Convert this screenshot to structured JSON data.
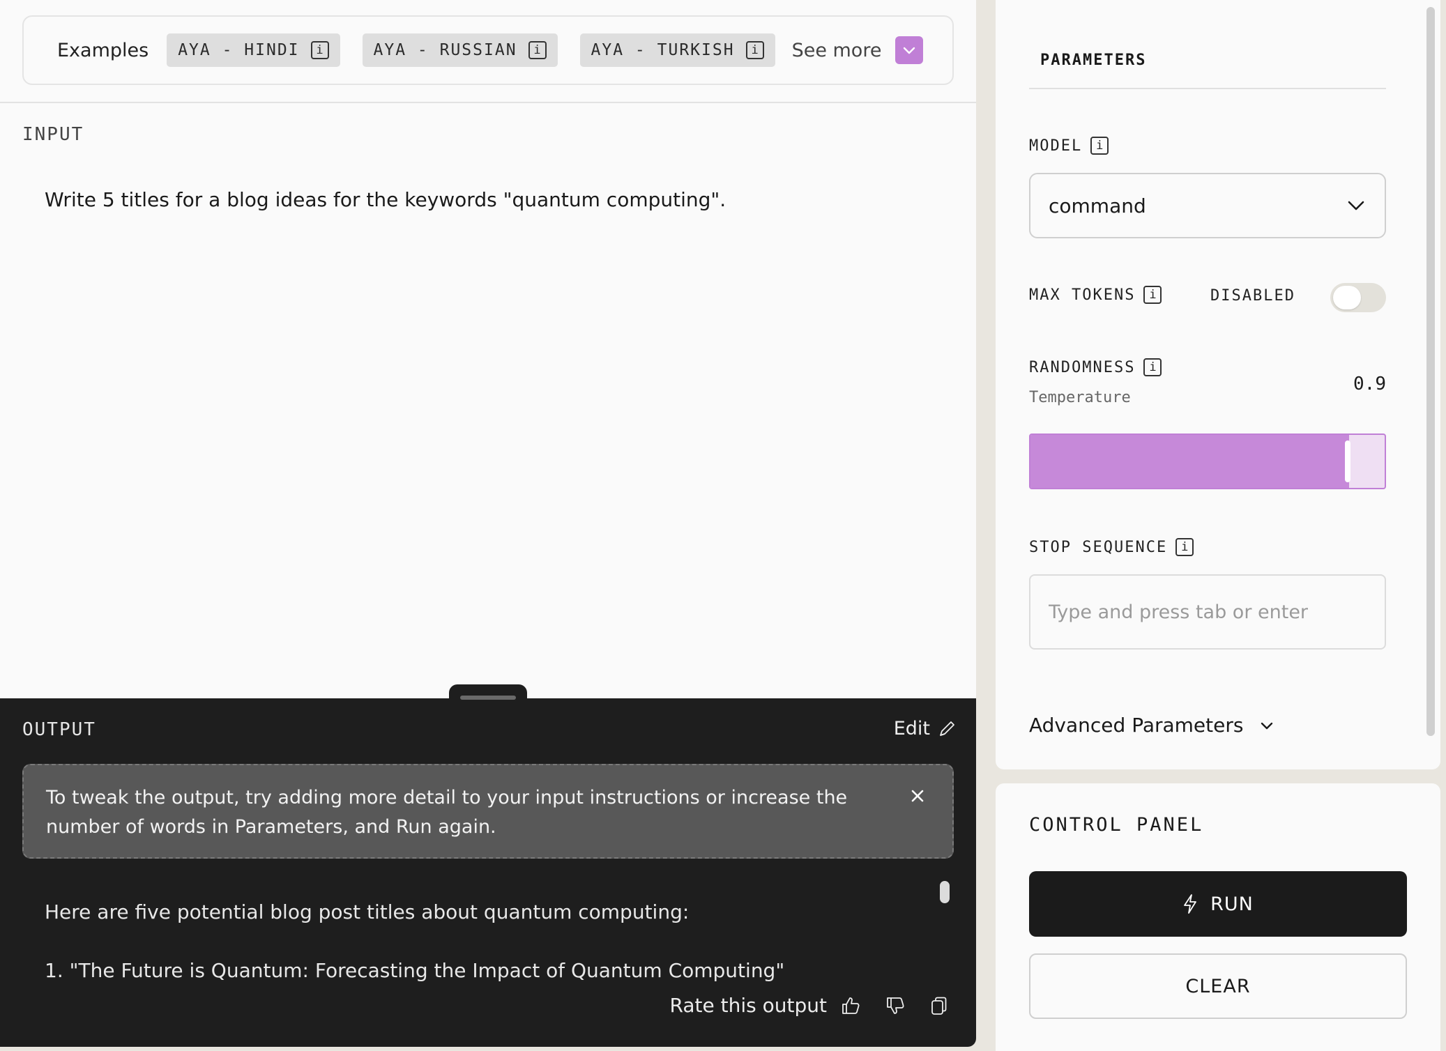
{
  "examples": {
    "label": "Examples",
    "chips": [
      {
        "label": "AYA - HINDI"
      },
      {
        "label": "AYA - RUSSIAN"
      },
      {
        "label": "AYA - TURKISH"
      }
    ],
    "see_more": "See more",
    "info_glyph": "i"
  },
  "input": {
    "label": "INPUT",
    "text": "Write 5 titles for a blog ideas for the keywords \"quantum computing\"."
  },
  "output": {
    "label": "OUTPUT",
    "edit_label": "Edit",
    "tip": "To tweak the output, try adding more detail to your input instructions or increase the number of words in Parameters, and Run again.",
    "lines": [
      "Here are five potential blog post titles about quantum computing:",
      "1. \"The Future is Quantum: Forecasting the Impact of Quantum Computing\""
    ],
    "rate_label": "Rate this output"
  },
  "parameters": {
    "title": "PARAMETERS",
    "model_label": "MODEL",
    "model_value": "command",
    "max_tokens_label": "MAX TOKENS",
    "max_tokens_state": "DISABLED",
    "max_tokens_enabled": false,
    "randomness_label": "RANDOMNESS",
    "temperature_label": "Temperature",
    "temperature_value": "0.9",
    "temperature_fraction": 0.9,
    "stop_sequence_label": "STOP SEQUENCE",
    "stop_sequence_placeholder": "Type and press tab or enter",
    "advanced_label": "Advanced Parameters"
  },
  "control_panel": {
    "title": "CONTROL PANEL",
    "run_label": "RUN",
    "clear_label": "CLEAR"
  },
  "colors": {
    "accent": "#c07fd6",
    "output_bg": "#1e1e1e",
    "run_bg": "#1b1b1b"
  },
  "icons": [
    "info-icon",
    "chevron-down-icon",
    "pencil-icon",
    "close-icon",
    "thumbs-up-icon",
    "thumbs-down-icon",
    "copy-icon",
    "lightning-icon"
  ]
}
